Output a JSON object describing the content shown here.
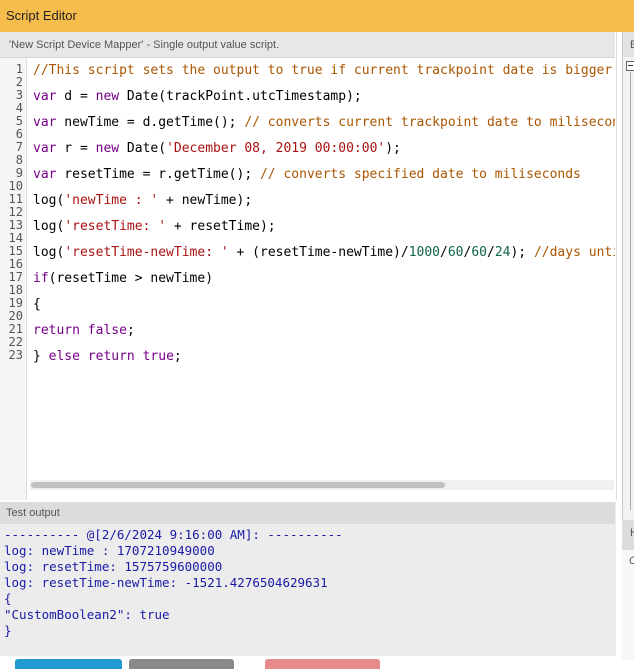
{
  "window": {
    "title": "Script Editor"
  },
  "editor": {
    "header": "'New Script Device Mapper' - Single output value script.",
    "line_numbers": [
      "1",
      "2",
      "3",
      "4",
      "5",
      "6",
      "7",
      "8",
      "9",
      "10",
      "11",
      "12",
      "13",
      "14",
      "15",
      "16",
      "17",
      "18",
      "19",
      "20",
      "21",
      "22",
      "23"
    ],
    "lines": [
      {
        "n": 1,
        "parts": [
          {
            "t": "//This script sets the output to true if current trackpoint date is bigger than specified",
            "c": "cm"
          }
        ]
      },
      {
        "n": 3,
        "parts": [
          {
            "t": "var",
            "c": "kw"
          },
          {
            "t": " d = "
          },
          {
            "t": "new",
            "c": "kw"
          },
          {
            "t": " Date(trackPoint.utcTimestamp);"
          }
        ]
      },
      {
        "n": 5,
        "parts": [
          {
            "t": "var",
            "c": "kw"
          },
          {
            "t": " newTime = d.getTime(); "
          },
          {
            "t": "// converts current trackpoint date to miliseconds",
            "c": "cm"
          }
        ]
      },
      {
        "n": 7,
        "parts": [
          {
            "t": "var",
            "c": "kw"
          },
          {
            "t": " r = "
          },
          {
            "t": "new",
            "c": "kw"
          },
          {
            "t": " Date("
          },
          {
            "t": "'December 08, 2019 00:00:00'",
            "c": "st"
          },
          {
            "t": ");"
          }
        ]
      },
      {
        "n": 9,
        "parts": [
          {
            "t": "var",
            "c": "kw"
          },
          {
            "t": " resetTime = r.getTime(); "
          },
          {
            "t": "// converts specified date to miliseconds",
            "c": "cm"
          }
        ]
      },
      {
        "n": 11,
        "parts": [
          {
            "t": "log("
          },
          {
            "t": "'newTime : '",
            "c": "st"
          },
          {
            "t": " + newTime);"
          }
        ]
      },
      {
        "n": 13,
        "parts": [
          {
            "t": "log("
          },
          {
            "t": "'resetTime: '",
            "c": "st"
          },
          {
            "t": " + resetTime);"
          }
        ]
      },
      {
        "n": 15,
        "parts": [
          {
            "t": "log("
          },
          {
            "t": "'resetTime-newTime: '",
            "c": "st"
          },
          {
            "t": " + (resetTime-newTime)/"
          },
          {
            "t": "1000",
            "c": "nu"
          },
          {
            "t": "/"
          },
          {
            "t": "60",
            "c": "nu"
          },
          {
            "t": "/"
          },
          {
            "t": "60",
            "c": "nu"
          },
          {
            "t": "/"
          },
          {
            "t": "24",
            "c": "nu"
          },
          {
            "t": "); "
          },
          {
            "t": "//days until",
            "c": "cm"
          }
        ]
      },
      {
        "n": 17,
        "parts": [
          {
            "t": "if",
            "c": "kw"
          },
          {
            "t": "(resetTime > newTime)"
          }
        ]
      },
      {
        "n": 19,
        "parts": [
          {
            "t": "{"
          }
        ]
      },
      {
        "n": 21,
        "parts": [
          {
            "t": "return",
            "c": "kw"
          },
          {
            "t": " "
          },
          {
            "t": "false",
            "c": "kw"
          },
          {
            "t": ";"
          }
        ]
      },
      {
        "n": 23,
        "parts": [
          {
            "t": "} "
          },
          {
            "t": "else",
            "c": "kw"
          },
          {
            "t": " "
          },
          {
            "t": "return",
            "c": "kw"
          },
          {
            "t": " "
          },
          {
            "t": "true",
            "c": "kw"
          },
          {
            "t": ";"
          }
        ]
      }
    ]
  },
  "output": {
    "header": "Test output",
    "lines": [
      "---------- @[2/6/2024 9:16:00 AM]: ----------",
      "log: newTime : 1707210949000",
      "log: resetTime: 1575759600000",
      "log: resetTime-newTime: -1521.4276504629631",
      "{",
      "\"CustomBoolean2\": true",
      "}"
    ]
  },
  "right_panel": {
    "header_letter_top": "E",
    "header_letter_bottom": "H",
    "sub_letter": "C"
  },
  "colors": {
    "titlebar": "#f6bd4d",
    "keyword": "#770088",
    "string": "#aa1111",
    "comment": "#aa5500",
    "number": "#116644",
    "output_text": "#1a1aa6",
    "button_primary": "#1f9bd1",
    "button_secondary": "#8a8a8a",
    "button_danger": "#e78a8a"
  }
}
